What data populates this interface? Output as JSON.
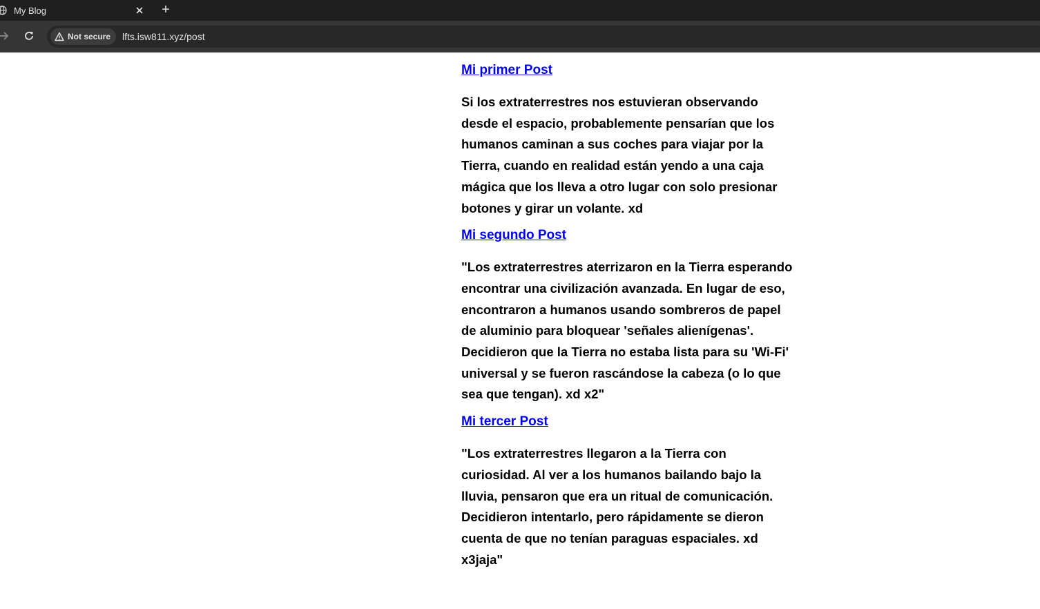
{
  "browser": {
    "tab": {
      "title": "My Blog",
      "close_icon": "close-icon"
    },
    "new_tab_label": "+",
    "security_label": "Not secure",
    "url": "lfts.isw811.xyz/post"
  },
  "posts": [
    {
      "title": "Mi primer Post",
      "body": "Si los extraterrestres nos estuvieran observando desde el espacio, probablemente pensarían que los humanos caminan a sus coches para viajar por la Tierra, cuando en realidad están yendo a una caja mágica que los lleva a otro lugar con solo presionar botones y girar un volante. xd"
    },
    {
      "title": "Mi segundo Post",
      "body": "\"Los extraterrestres aterrizaron en la Tierra esperando encontrar una civilización avanzada. En lugar de eso, encontraron a humanos usando sombreros de papel de aluminio para bloquear 'señales alienígenas'. Decidieron que la Tierra no estaba lista para su 'Wi-Fi' universal y se fueron rascándose la cabeza (o lo que sea que tengan). xd x2\""
    },
    {
      "title": "Mi tercer Post",
      "body": "\"Los extraterrestres llegaron a la Tierra con curiosidad. Al ver a los humanos bailando bajo la lluvia, pensaron que era un ritual de comunicación. Decidieron intentarlo, pero rápidamente se dieron cuenta de que no tenían paraguas espaciales. xd x3jaja\""
    }
  ],
  "colors": {
    "link": "#0000ee",
    "text": "#000000",
    "chrome_bg": "#1f1f1f",
    "toolbar_bg": "#353535"
  }
}
